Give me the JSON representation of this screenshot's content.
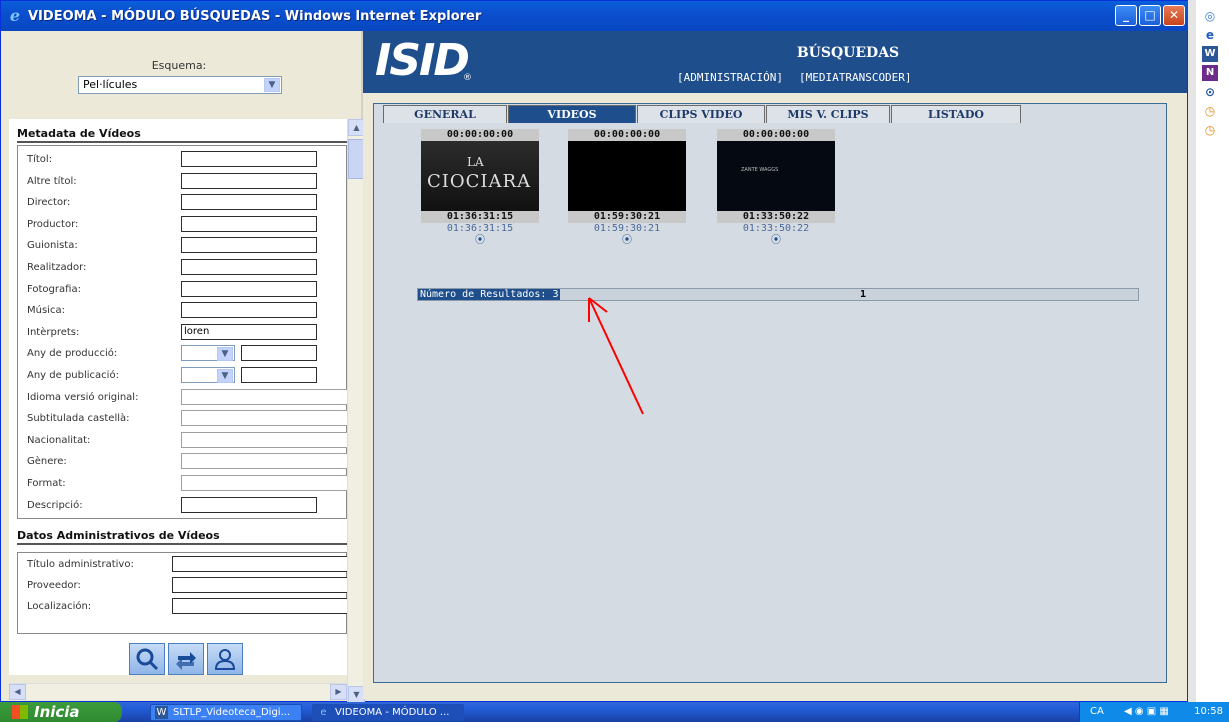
{
  "window": {
    "title": "VIDEOMA - MÓDULO BÚSQUEDAS - Windows Internet Explorer",
    "min_glyph": "_",
    "max_glyph": "□",
    "close_glyph": "✕"
  },
  "left": {
    "esquema_label": "Esquema:",
    "esquema_value": "Pel·lícules",
    "metadata_title": "Metadata de Vídeos",
    "fields": [
      {
        "label": "Títol:",
        "value": ""
      },
      {
        "label": "Altre títol:",
        "value": ""
      },
      {
        "label": "Director:",
        "value": ""
      },
      {
        "label": "Productor:",
        "value": ""
      },
      {
        "label": "Guionista:",
        "value": ""
      },
      {
        "label": "Realitzador:",
        "value": ""
      },
      {
        "label": "Fotografia:",
        "value": ""
      },
      {
        "label": "Música:",
        "value": ""
      },
      {
        "label": "Intèrprets:",
        "value": "loren"
      },
      {
        "label": "Any de producció:",
        "value": ""
      },
      {
        "label": "Any de publicació:",
        "value": ""
      },
      {
        "label": "Idioma versió original:",
        "value": ""
      },
      {
        "label": "Subtitulada castellà:",
        "value": ""
      },
      {
        "label": "Nacionalitat:",
        "value": ""
      },
      {
        "label": "Gènere:",
        "value": ""
      },
      {
        "label": "Format:",
        "value": ""
      },
      {
        "label": "Descripció:",
        "value": ""
      }
    ],
    "admin_title": "Datos Administrativos de Vídeos",
    "admin_fields": [
      {
        "label": "Título administrativo:",
        "value": ""
      },
      {
        "label": "Proveedor:",
        "value": ""
      },
      {
        "label": "Localización:",
        "value": ""
      }
    ],
    "buttons": {
      "search_icon": "search-icon",
      "swap_icon": "swap-icon",
      "user_icon": "user-icon"
    }
  },
  "header": {
    "logo": "ISID",
    "logo_reg": "®",
    "title": "BÚSQUEDAS",
    "links": [
      "[ADMINISTRACIÓN]",
      "[MEDIATRANSCODER]"
    ]
  },
  "tabs": [
    {
      "label": "GENERAL",
      "active": false
    },
    {
      "label": "VIDEOS",
      "active": true
    },
    {
      "label": "CLIPS VIDEO",
      "active": false
    },
    {
      "label": "MIS V. CLIPS",
      "active": false
    },
    {
      "label": "LISTADO",
      "active": false
    }
  ],
  "results": [
    {
      "start": "00:00:00:00",
      "end": "01:36:31:15",
      "duration": "01:36:31:15",
      "title_text": "LA\nCIOCIARA"
    },
    {
      "start": "00:00:00:00",
      "end": "01:59:30:21",
      "duration": "01:59:30:21",
      "title_text": ""
    },
    {
      "start": "00:00:00:00",
      "end": "01:33:50:22",
      "duration": "01:33:50:22",
      "title_text": "ZANTE WAGGS"
    }
  ],
  "results_label": "Número de Resultados: 3",
  "results_page": "1",
  "taskbar": {
    "start": "Inicia",
    "tasks": [
      "SLTLP_Videoteca_Digi...",
      "VIDEOMA - MÓDULO ..."
    ],
    "lang": "CA",
    "clock": "10:58"
  },
  "colors": {
    "header": "#1e4f8c",
    "content_bg": "#d5dbe2",
    "annotation_arrow": "#ff0000"
  }
}
